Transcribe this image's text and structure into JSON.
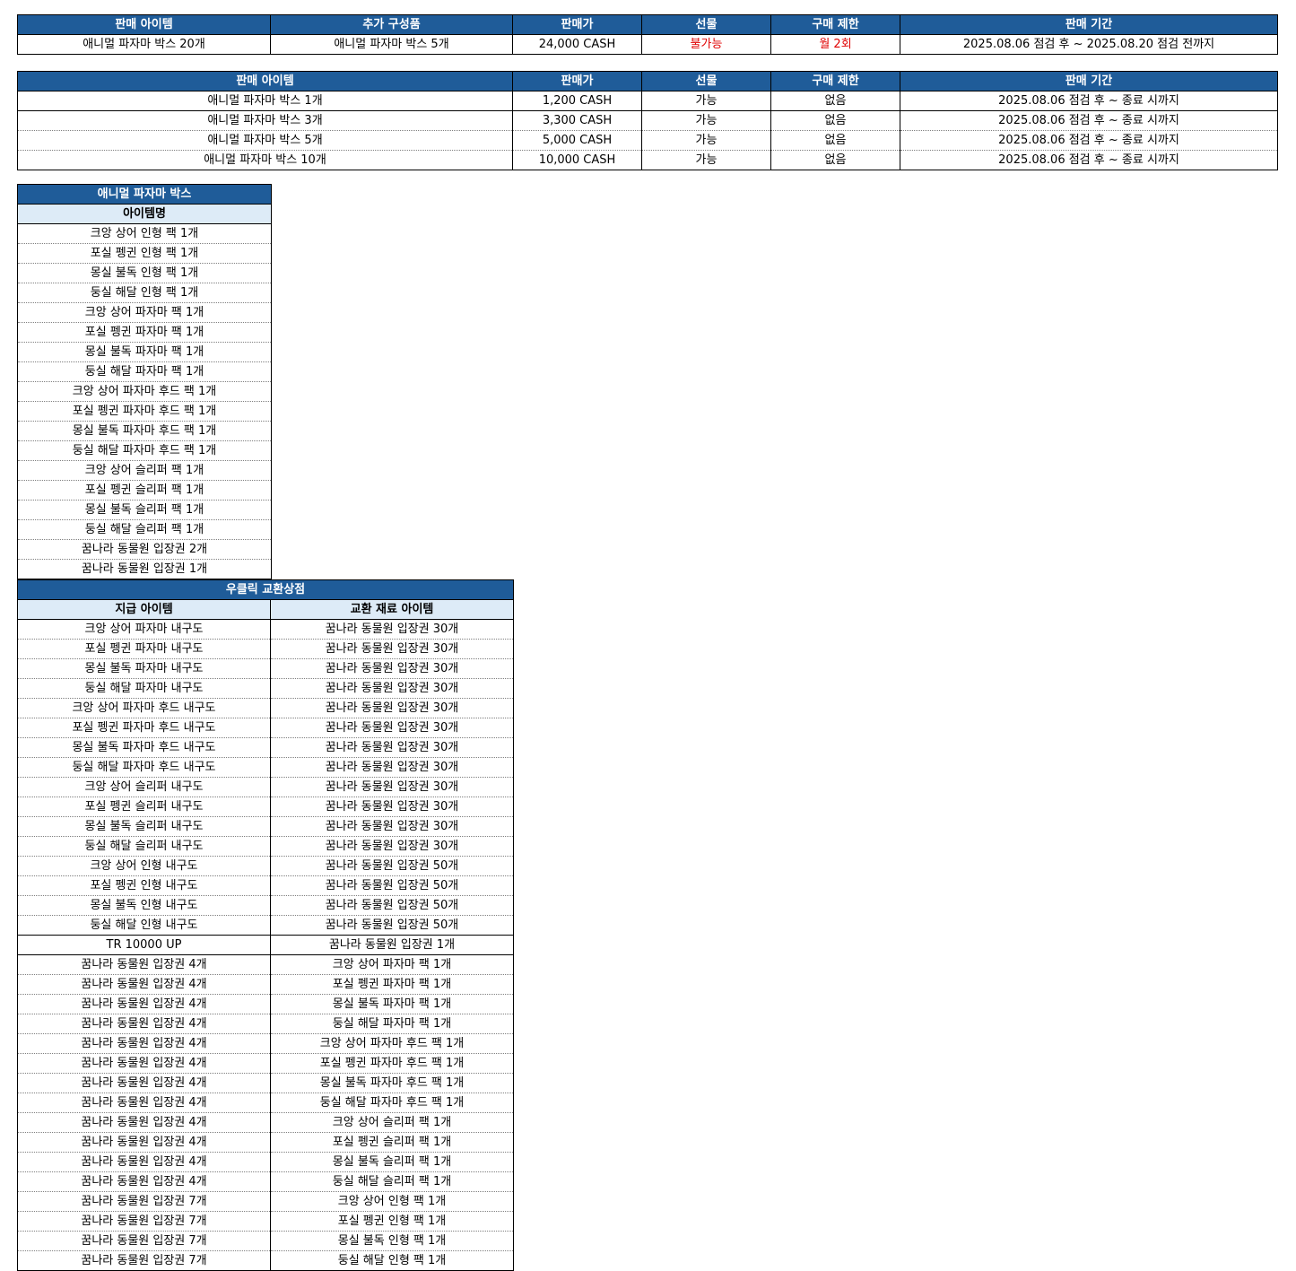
{
  "table1": {
    "headers": [
      "판매 아이템",
      "추가 구성품",
      "판매가",
      "선물",
      "구매 제한",
      "판매 기간"
    ],
    "row": [
      "애니멀 파자마 박스 20개",
      "애니멀 파자마 박스 5개",
      "24,000 CASH",
      "불가능",
      "월 2회",
      "2025.08.06 점검 후 ~ 2025.08.20 점검 전까지"
    ]
  },
  "table2": {
    "headers": [
      "판매 아이템",
      "판매가",
      "선물",
      "구매 제한",
      "판매 기간"
    ],
    "rows": [
      [
        "애니멀 파자마 박스 1개",
        "1,200 CASH",
        "가능",
        "없음",
        "2025.08.06 점검 후 ~ 종료 시까지"
      ],
      [
        "애니멀 파자마 박스 3개",
        "3,300 CASH",
        "가능",
        "없음",
        "2025.08.06 점검 후 ~ 종료 시까지"
      ],
      [
        "애니멀 파자마 박스 5개",
        "5,000 CASH",
        "가능",
        "없음",
        "2025.08.06 점검 후 ~ 종료 시까지"
      ],
      [
        "애니멀 파자마 박스 10개",
        "10,000 CASH",
        "가능",
        "없음",
        "2025.08.06 점검 후 ~ 종료 시까지"
      ]
    ]
  },
  "table3": {
    "title": "애니멀 파자마 박스",
    "subheader": "아이템명",
    "items": [
      "크앙 상어 인형 팩 1개",
      "포실 펭귄 인형 팩 1개",
      "몽실 불독 인형 팩 1개",
      "둥실 해달 인형 팩 1개",
      "크앙 상어 파자마 팩 1개",
      "포실 펭귄 파자마 팩 1개",
      "몽실 불독 파자마 팩 1개",
      "둥실 해달 파자마 팩 1개",
      "크앙 상어 파자마 후드 팩 1개",
      "포실 펭귄 파자마 후드 팩 1개",
      "몽실 불독 파자마 후드 팩 1개",
      "둥실 해달 파자마 후드 팩 1개",
      "크앙 상어 슬리퍼 팩 1개",
      "포실 펭귄 슬리퍼 팩 1개",
      "몽실 불독 슬리퍼 팩 1개",
      "둥실 해달 슬리퍼 팩 1개",
      "꿈나라 동물원 입장권 2개",
      "꿈나라 동물원 입장권 1개"
    ]
  },
  "table4": {
    "title": "우클릭 교환상점",
    "headers": [
      "지급 아이템",
      "교환 재료 아이템"
    ],
    "rows": [
      [
        "크앙 상어 파자마 내구도",
        "꿈나라 동물원 입장권 30개"
      ],
      [
        "포실 펭귄 파자마 내구도",
        "꿈나라 동물원 입장권 30개"
      ],
      [
        "몽실 불독 파자마 내구도",
        "꿈나라 동물원 입장권 30개"
      ],
      [
        "둥실 해달 파자마 내구도",
        "꿈나라 동물원 입장권 30개"
      ],
      [
        "크앙 상어 파자마 후드 내구도",
        "꿈나라 동물원 입장권 30개"
      ],
      [
        "포실 펭귄 파자마 후드 내구도",
        "꿈나라 동물원 입장권 30개"
      ],
      [
        "몽실 불독 파자마 후드 내구도",
        "꿈나라 동물원 입장권 30개"
      ],
      [
        "둥실 해달 파자마 후드 내구도",
        "꿈나라 동물원 입장권 30개"
      ],
      [
        "크앙 상어 슬리퍼 내구도",
        "꿈나라 동물원 입장권 30개"
      ],
      [
        "포실 펭귄 슬리퍼 내구도",
        "꿈나라 동물원 입장권 30개"
      ],
      [
        "몽실 불독 슬리퍼 내구도",
        "꿈나라 동물원 입장권 30개"
      ],
      [
        "둥실 해달 슬리퍼 내구도",
        "꿈나라 동물원 입장권 30개"
      ],
      [
        "크앙 상어 인형 내구도",
        "꿈나라 동물원 입장권 50개"
      ],
      [
        "포실 펭귄 인형 내구도",
        "꿈나라 동물원 입장권 50개"
      ],
      [
        "몽실 불독 인형 내구도",
        "꿈나라 동물원 입장권 50개"
      ],
      [
        "둥실 해달 인형 내구도",
        "꿈나라 동물원 입장권 50개"
      ],
      [
        "TR 10000 UP",
        "꿈나라 동물원 입장권 1개"
      ],
      [
        "꿈나라 동물원 입장권 4개",
        "크앙 상어 파자마 팩 1개"
      ],
      [
        "꿈나라 동물원 입장권 4개",
        "포실 펭귄 파자마 팩 1개"
      ],
      [
        "꿈나라 동물원 입장권 4개",
        "몽실 불독 파자마 팩 1개"
      ],
      [
        "꿈나라 동물원 입장권 4개",
        "둥실 해달 파자마 팩 1개"
      ],
      [
        "꿈나라 동물원 입장권 4개",
        "크앙 상어 파자마 후드 팩 1개"
      ],
      [
        "꿈나라 동물원 입장권 4개",
        "포실 펭귄 파자마 후드 팩 1개"
      ],
      [
        "꿈나라 동물원 입장권 4개",
        "몽실 불독 파자마 후드 팩 1개"
      ],
      [
        "꿈나라 동물원 입장권 4개",
        "둥실 해달 파자마 후드 팩 1개"
      ],
      [
        "꿈나라 동물원 입장권 4개",
        "크앙 상어 슬리퍼 팩 1개"
      ],
      [
        "꿈나라 동물원 입장권 4개",
        "포실 펭귄 슬리퍼 팩 1개"
      ],
      [
        "꿈나라 동물원 입장권 4개",
        "몽실 불독 슬리퍼 팩 1개"
      ],
      [
        "꿈나라 동물원 입장권 4개",
        "둥실 해달 슬리퍼 팩 1개"
      ],
      [
        "꿈나라 동물원 입장권 7개",
        "크앙 상어 인형 팩 1개"
      ],
      [
        "꿈나라 동물원 입장권 7개",
        "포실 펭귄 인형 팩 1개"
      ],
      [
        "꿈나라 동물원 입장권 7개",
        "몽실 불독 인형 팩 1개"
      ],
      [
        "꿈나라 동물원 입장권 7개",
        "둥실 해달 인형 팩 1개"
      ]
    ]
  }
}
